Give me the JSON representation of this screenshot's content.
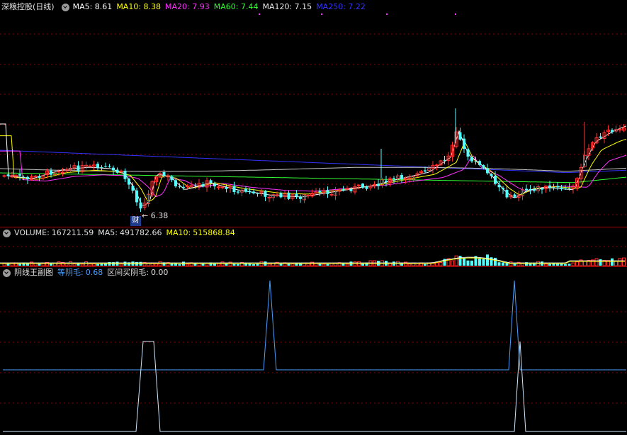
{
  "main_header": {
    "title": "深粮控股(日线)",
    "ma": [
      {
        "label": "MA5:",
        "value": "8.61",
        "color": "#ffffff"
      },
      {
        "label": "MA10:",
        "value": "8.38",
        "color": "#ffff00"
      },
      {
        "label": "MA20:",
        "value": "7.93",
        "color": "#ff33ff"
      },
      {
        "label": "MA60:",
        "value": "7.44",
        "color": "#33ff33"
      },
      {
        "label": "MA120:",
        "value": "7.15",
        "color": "#e8e8e8"
      },
      {
        "label": "MA250:",
        "value": "7.22",
        "color": "#3333ff"
      }
    ]
  },
  "markers": {
    "low_label": "6.38",
    "badge": "财"
  },
  "volume_header": {
    "vol_label": "VOLUME:",
    "vol_value": "167211.59",
    "ma5_label": "MA5:",
    "ma5_value": "491782.66",
    "ma10_label": "MA10:",
    "ma10_value": "515868.84"
  },
  "indicator_header": {
    "title": "阴线王副图",
    "item1_label": "等阴毛:",
    "item1_value": "0.68",
    "item2_label": "区间买阴毛:",
    "item2_value": "0.00"
  },
  "colors": {
    "up": "#ff3232",
    "down": "#54ffff",
    "grid": "#8b0000",
    "separator": "#b00000",
    "indicator": "#4a9fff"
  }
}
